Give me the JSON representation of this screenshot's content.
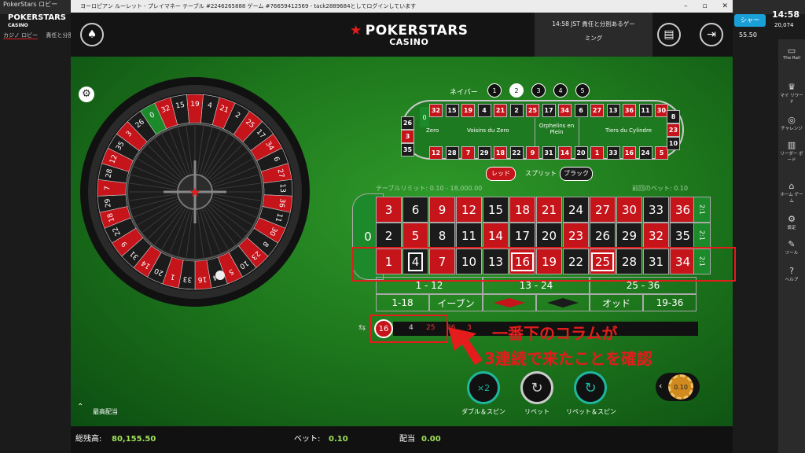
{
  "lobby": {
    "app_title": "PokerStars ロビー",
    "logo_main": "POKERSTARS",
    "logo_sub": "CASINO",
    "tabs": [
      "カジノ ロビー",
      "責任と分別ある"
    ],
    "right_btn": "シャー",
    "time": "14:58",
    "balance_frag": "55.50",
    "right_balance": "20,074"
  },
  "window": {
    "title": "ヨーロピアン ルーレット - プレイマネー テーブル #2246265888 ゲーム #76659412569 - tack2889684としてログインしています",
    "ctrl_min": "–",
    "ctrl_max": "▫",
    "ctrl_close": "✕"
  },
  "header": {
    "brand": "POKERSTARS",
    "brand_sub": "CASINO",
    "responsible_line1": "14:58 JST 責任と分別あるゲー",
    "responsible_line2": "ミング"
  },
  "racetrack": {
    "neighbors_label": "ネイバー",
    "neighbor_options": [
      "1",
      "2",
      "3",
      "4",
      "5"
    ],
    "neighbor_selected": "2",
    "top_row": [
      "32",
      "15",
      "19",
      "4",
      "21",
      "2",
      "25",
      "17",
      "34",
      "6",
      "27",
      "13",
      "36",
      "11",
      "30"
    ],
    "bottom_row": [
      "12",
      "28",
      "7",
      "29",
      "18",
      "22",
      "9",
      "31",
      "14",
      "20",
      "1",
      "33",
      "16",
      "24",
      "5"
    ],
    "left_col": [
      "26",
      "3",
      "35"
    ],
    "right_col": [
      "8",
      "23",
      "10"
    ],
    "zero": "0",
    "sections": [
      "Zero",
      "Voisins du Zero",
      "Orphelins en Plein",
      "Tiers du Cylindre"
    ],
    "red_btn": "レッド",
    "split_label": "スプリット",
    "black_btn": "ブラック"
  },
  "table": {
    "limit_label": "テーブルリミット: 0.10 - 18,000.00",
    "last_bet_label": "前回のベット: 0.10",
    "row_top": [
      "3",
      "6",
      "9",
      "12",
      "15",
      "18",
      "21",
      "24",
      "27",
      "30",
      "33",
      "36"
    ],
    "row_mid": [
      "2",
      "5",
      "8",
      "11",
      "14",
      "17",
      "20",
      "23",
      "26",
      "29",
      "32",
      "35"
    ],
    "row_bot": [
      "1",
      "4",
      "7",
      "10",
      "13",
      "16",
      "19",
      "22",
      "25",
      "28",
      "31",
      "34"
    ],
    "zero": "0",
    "col_bet": "2:1",
    "dozens": [
      "1 - 12",
      "13 - 24",
      "25 - 36"
    ],
    "evens": [
      "1-18",
      "イーブン",
      "",
      "",
      "オッド",
      "19-36"
    ]
  },
  "history": {
    "latest": "16",
    "values": [
      "4",
      "25",
      "36",
      "3"
    ]
  },
  "annotation": {
    "line1": "一番下のコラムが",
    "line2": "3連続で来たことを確認"
  },
  "controls": {
    "double_label": "ダブル＆スピン",
    "repeat_label": "リペット",
    "repeat_spin_label": "リペット＆スピン",
    "chip_value": "0.10",
    "stats_label": "最高配当"
  },
  "footer": {
    "balance_label": "総残高:",
    "balance_value": "80,155.50",
    "bet_label": "ベット:",
    "bet_value": "0.10",
    "payout_label": "配当",
    "payout_value": "0.00"
  },
  "sidebar": {
    "items": [
      "The Rail",
      "マイ リワード",
      "チャレンジ",
      "リーダー ボード",
      "ホーム ゲーム",
      "設定",
      "ツール",
      "ヘルプ"
    ]
  },
  "colors": {
    "red": "#c6141b",
    "black": "#1b1b1b",
    "felt": "#1f7a1d",
    "gold": "#d08a1e"
  }
}
